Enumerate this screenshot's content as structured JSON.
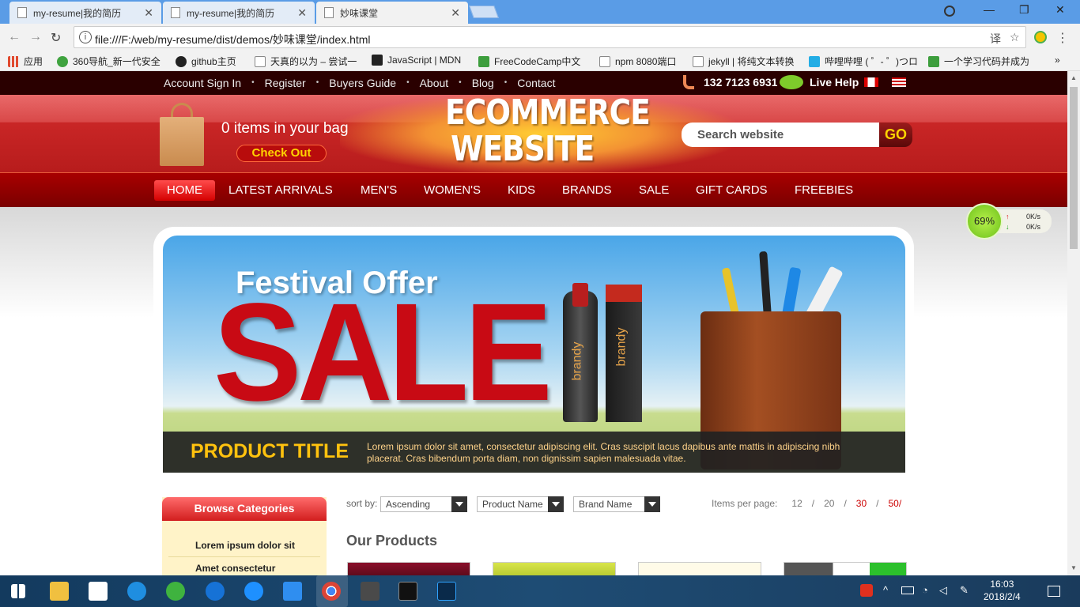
{
  "browser": {
    "tabs": [
      {
        "title": "my-resume|我的简历",
        "close": "✕"
      },
      {
        "title": "my-resume|我的简历",
        "close": "✕"
      },
      {
        "title": "妙味课堂",
        "close": "✕"
      }
    ],
    "url": "file:///F:/web/my-resume/dist/demos/妙味课堂/index.html",
    "window_controls": {
      "minimize": "—",
      "restore": "❐",
      "close": "✕"
    },
    "bookmarks": [
      {
        "label": "应用",
        "color": "#e04a2f"
      },
      {
        "label": "360导航_新一代安全",
        "color": "#3fa33f"
      },
      {
        "label": "github主页",
        "color": "#222222"
      },
      {
        "label": "天真的以为 – 尝试一",
        "color": "#888888"
      },
      {
        "label": "JavaScript | MDN",
        "color": "#222222"
      },
      {
        "label": "FreeCodeCamp中文",
        "color": "#3d9e3d"
      },
      {
        "label": "npm 8080端口",
        "color": "#888888"
      },
      {
        "label": "jekyll | 将纯文本转换",
        "color": "#888888"
      },
      {
        "label": "哔哩哔哩 ( ゜- ゜)つロ",
        "color": "#23ade5"
      },
      {
        "label": "一个学习代码并成为",
        "color": "#3d9e3d"
      }
    ],
    "more_bookmarks": "»"
  },
  "site": {
    "topnav": [
      "Account Sign In",
      "Register",
      "Buyers Guide",
      "About",
      "Blog",
      "Contact"
    ],
    "topnav_separator": "•",
    "phone": "132 7123 6931",
    "live_help": "Live Help",
    "bag_text": "0 items in your bag",
    "checkout": "Check Out",
    "logo_line1": "ECOMMERCE",
    "logo_line2": "WEBSITE",
    "search_placeholder": "Search website",
    "search_go": "GO",
    "mainnav": [
      "HOME",
      "LATEST ARRIVALS",
      "MEN'S",
      "WOMEN'S",
      "KIDS",
      "BRANDS",
      "SALE",
      "GIFT CARDS",
      "FREEBIES"
    ],
    "banner": {
      "festival": "Festival Offer",
      "sale": "SALE",
      "bottle_label": "brandy",
      "box_label": "brandy",
      "product_title": "PRODUCT TITLE",
      "product_desc": "Lorem ipsum dolor sit amet, consectetur adipiscing elit. Cras suscipit lacus dapibus ante mattis in adipiscing nibh placerat. Cras bibendum porta diam, non dignissim sapien malesuada vitae."
    },
    "sidebar": {
      "title": "Browse Categories",
      "items": [
        "Lorem ipsum dolor sit",
        "Amet consectetur"
      ]
    },
    "sort": {
      "label": "sort by:",
      "order": "Ascending",
      "name": "Product Name",
      "brand": "Brand Name"
    },
    "per_page": {
      "label": "Items per page:",
      "options": [
        "12",
        "20",
        "30",
        "50/"
      ],
      "separator": "/"
    },
    "our_products": "Our Products"
  },
  "net_widget": {
    "percent": "69%",
    "up": "0K/s",
    "down": "0K/s",
    "up_arrow": "↑",
    "down_arrow": "↓"
  },
  "taskbar": {
    "time": "16:03",
    "date": "2018/2/4"
  }
}
